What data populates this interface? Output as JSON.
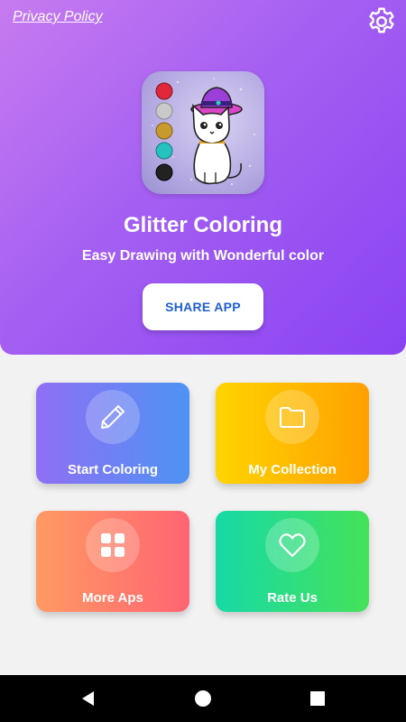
{
  "header": {
    "privacy_link": "Privacy Policy",
    "settings_icon": "gear-icon"
  },
  "hero": {
    "title": "Glitter Coloring",
    "subtitle": "Easy Drawing with Wonderful color",
    "share_button": "SHARE APP",
    "app_icon": "glitter-cat-icon",
    "palette_colors": [
      "#e0283a",
      "#c9c9c9",
      "#c79a2e",
      "#25c2c0",
      "#222222"
    ]
  },
  "menu": {
    "items": [
      {
        "label": "Start Coloring",
        "icon": "pencil-icon"
      },
      {
        "label": "My Collection",
        "icon": "folder-icon"
      },
      {
        "label": "More Aps",
        "icon": "grid-icon"
      },
      {
        "label": "Rate Us",
        "icon": "heart-icon"
      }
    ]
  },
  "navbar": {
    "back": "back-icon",
    "home": "home-icon",
    "recents": "recents-icon"
  },
  "colors": {
    "hero_start": "#c77bf0",
    "hero_end": "#8a43f3",
    "share_text": "#1f5fd1"
  }
}
